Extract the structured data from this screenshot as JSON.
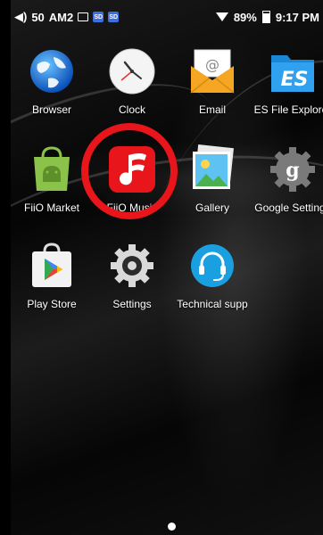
{
  "status_bar": {
    "volume": "50",
    "audio_format": "AM2",
    "sd1": "SD",
    "sd2": "SD",
    "battery": "89%",
    "time": "9:17 PM"
  },
  "apps": [
    {
      "label": "Browser",
      "icon": "globe-icon"
    },
    {
      "label": "Clock",
      "icon": "clock-icon"
    },
    {
      "label": "Email",
      "icon": "envelope-icon"
    },
    {
      "label": "ES File Explorer",
      "icon": "es-file-explorer-icon"
    },
    {
      "label": "FiiO Market",
      "icon": "android-bag-icon"
    },
    {
      "label": "FiiO Music",
      "icon": "fiio-music-icon"
    },
    {
      "label": "Gallery",
      "icon": "gallery-icon"
    },
    {
      "label": "Google Settings",
      "icon": "google-settings-icon"
    },
    {
      "label": "Play Store",
      "icon": "play-store-icon"
    },
    {
      "label": "Settings",
      "icon": "gear-icon"
    },
    {
      "label": "Technical supp",
      "icon": "headset-icon"
    }
  ],
  "highlight_color": "#e8151b"
}
